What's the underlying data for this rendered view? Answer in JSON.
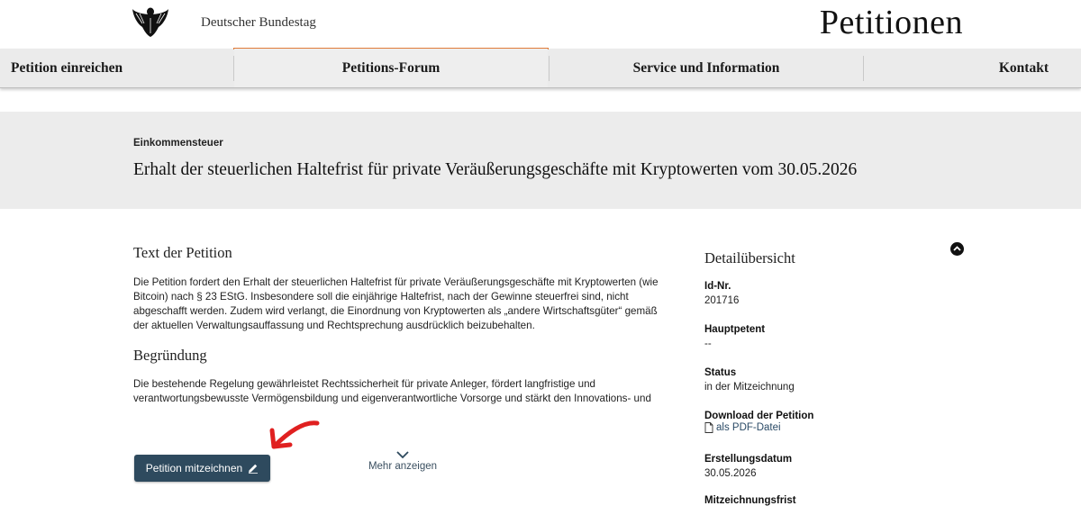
{
  "header": {
    "org_name": "Deutscher Bundestag",
    "site_title": "Petitionen"
  },
  "nav": {
    "items": [
      {
        "label": "Petition einreichen"
      },
      {
        "label": "Petitions-Forum",
        "active": true
      },
      {
        "label": "Service und Information"
      },
      {
        "label": "Kontakt"
      }
    ],
    "active_color": "#e07b39"
  },
  "petition": {
    "category": "Einkommensteuer",
    "title": "Erhalt der steuerlichen Haltefrist für private Veräußerungsgeschäfte mit Kryptowerten vom 30.05.2026"
  },
  "content": {
    "text_heading": "Text der Petition",
    "text_body": "Die Petition fordert den Erhalt der steuerlichen Haltefrist für private Veräußerungsgeschäfte mit Kryptowerten (wie Bitcoin) nach § 23 EStG. Insbesondere soll die einjährige Haltefrist, nach der Gewinne steuerfrei sind, nicht abgeschafft werden. Zudem wird verlangt, die Einordnung von Kryptowerten als „andere Wirtschaftsgüter“ gemäß der aktuellen Verwaltungsauffassung und Rechtsprechung ausdrücklich beizubehalten.",
    "reason_heading": "Begründung",
    "reason_body": "Die bestehende Regelung gewährleistet Rechtssicherheit für private Anleger, fördert langfristige und verantwortungsbewusste Vermögensbildung und eigenverantwortliche Vorsorge und stärkt den Innovations- und",
    "sign_button_label": "Petition mitzeichnen",
    "more_label": "Mehr anzeigen"
  },
  "sidebar": {
    "heading": "Detailübersicht",
    "id_label": "Id-Nr.",
    "id_value": "201716",
    "petent_label": "Hauptpetent",
    "petent_value": "--",
    "status_label": "Status",
    "status_value": "in der Mitzeichnung",
    "download_label": "Download der Petition",
    "download_link": "als PDF-Datei",
    "created_label": "Erstellungsdatum",
    "created_value": "30.05.2026",
    "deadline_label": "Mitzeichnungsfrist"
  },
  "colors": {
    "button_bg": "#2e4a5e",
    "band_bg": "#ececec",
    "annotation_arrow": "#e02020"
  },
  "icons": [
    "eagle-logo",
    "pencil-icon",
    "chevron-down-icon",
    "document-icon",
    "scroll-up-icon"
  ]
}
